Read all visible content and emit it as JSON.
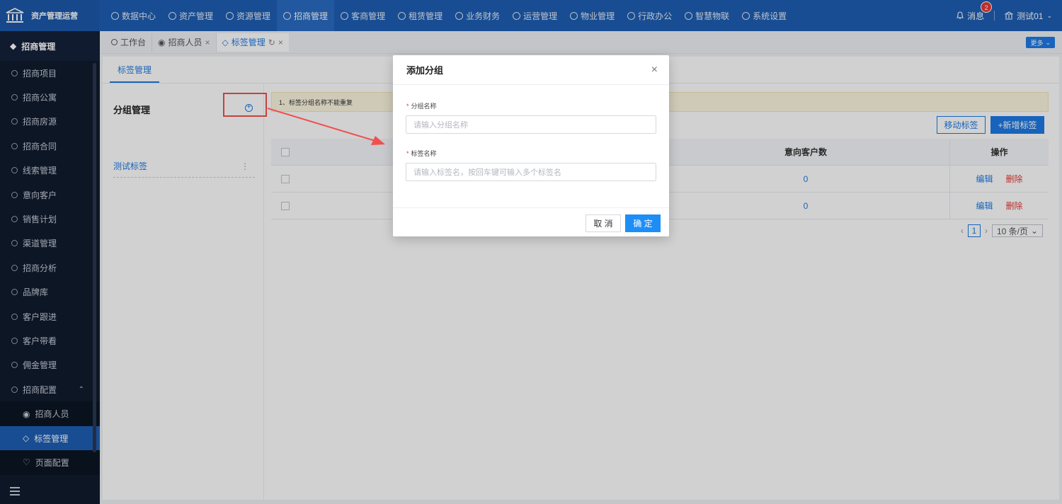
{
  "app": {
    "logo_text": "资产管理运营"
  },
  "topnav": [
    {
      "label": "数据中心",
      "icon": "clock-icon"
    },
    {
      "label": "资产管理",
      "icon": "cube-icon"
    },
    {
      "label": "资源管理",
      "icon": "doc-icon"
    },
    {
      "label": "招商管理",
      "icon": "tag-icon",
      "active": true
    },
    {
      "label": "客商管理",
      "icon": "users-icon"
    },
    {
      "label": "租赁管理",
      "icon": "house-icon"
    },
    {
      "label": "业务财务",
      "icon": "coin-icon"
    },
    {
      "label": "运营管理",
      "icon": "chart-icon"
    },
    {
      "label": "物业管理",
      "icon": "building-icon"
    },
    {
      "label": "行政办公",
      "icon": "monitor-icon"
    },
    {
      "label": "智慧物联",
      "icon": "iot-icon"
    },
    {
      "label": "系统设置",
      "icon": "gear-icon"
    }
  ],
  "topright": {
    "messages_label": "消息",
    "messages_count": "2",
    "user_label": "测试01"
  },
  "sidebar": {
    "header": "招商管理",
    "items": [
      "招商项目",
      "招商公寓",
      "招商房源",
      "招商合同",
      "线索管理",
      "意向客户",
      "销售计划",
      "渠道管理",
      "招商分析",
      "品牌库",
      "客户跟进",
      "客户带看",
      "佣金管理",
      "招商配置"
    ],
    "subitems": [
      "招商人员",
      "标签管理",
      "页面配置"
    ]
  },
  "tabs": [
    {
      "label": "工作台"
    },
    {
      "label": "招商人员"
    },
    {
      "label": "标签管理"
    }
  ],
  "more_label": "更多",
  "content": {
    "tab": "标签管理",
    "group_title": "分组管理",
    "group_item": "测试标签",
    "tip": "1、标签分组名称不能重复",
    "move_btn": "移动标签",
    "add_btn": "+新增标签",
    "table": {
      "headers": {
        "count": "意向客户数",
        "ops": "操作"
      },
      "rows": [
        {
          "count": "0",
          "edit": "编辑",
          "del": "删除"
        },
        {
          "count": "0",
          "edit": "编辑",
          "del": "删除"
        }
      ]
    },
    "pager": {
      "page": "1",
      "size": "10 条/页"
    }
  },
  "modal": {
    "title": "添加分组",
    "group_label": "分组名称",
    "group_placeholder": "请输入分组名称",
    "tag_label": "标签名称",
    "tag_placeholder": "请输入标签名，按回车键可输入多个标签名",
    "cancel": "取 消",
    "ok": "确 定"
  },
  "colors": {
    "brand": "#1e5fb4",
    "primary": "#1e7be6",
    "danger": "#e53935",
    "highlight": "#f0514f"
  }
}
